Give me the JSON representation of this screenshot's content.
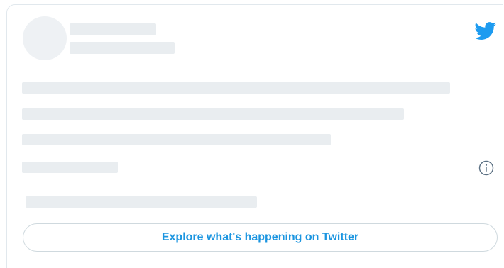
{
  "embed": {
    "explore_label": "Explore what's happening on Twitter"
  },
  "icons": {
    "brand": "twitter-bird-icon",
    "info": "info-icon"
  },
  "colors": {
    "brand_blue": "#1d9bf0",
    "link_blue": "#1b95e0",
    "skeleton": "#e9edf0",
    "border": "#cfd9de"
  }
}
